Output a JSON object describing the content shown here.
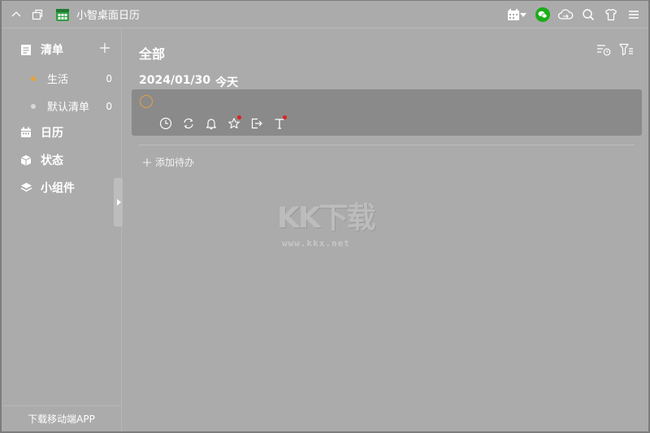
{
  "titlebar": {
    "app_title": "小智桌面日历"
  },
  "sidebar": {
    "lists_label": "清单",
    "sub_items": [
      {
        "label": "生活",
        "count": "0",
        "dot_color": "#e6a23c"
      },
      {
        "label": "默认清单",
        "count": "0",
        "dot_color": "#d8d8d8"
      }
    ],
    "calendar_label": "日历",
    "status_label": "状态",
    "widgets_label": "小组件",
    "footer_label": "下载移动端APP"
  },
  "main": {
    "title": "全部",
    "date_label": "2024/01/30",
    "today_label": "今天",
    "add_todo_label": "添加待办"
  },
  "watermark": {
    "brand": "KK下载",
    "url": "www.kkx.net"
  },
  "colors": {
    "background": "#ababab",
    "card": "#8a8a8a",
    "accent_orange": "#e6a23c",
    "notify_red": "#e02020",
    "wechat_green": "#1aad19"
  }
}
